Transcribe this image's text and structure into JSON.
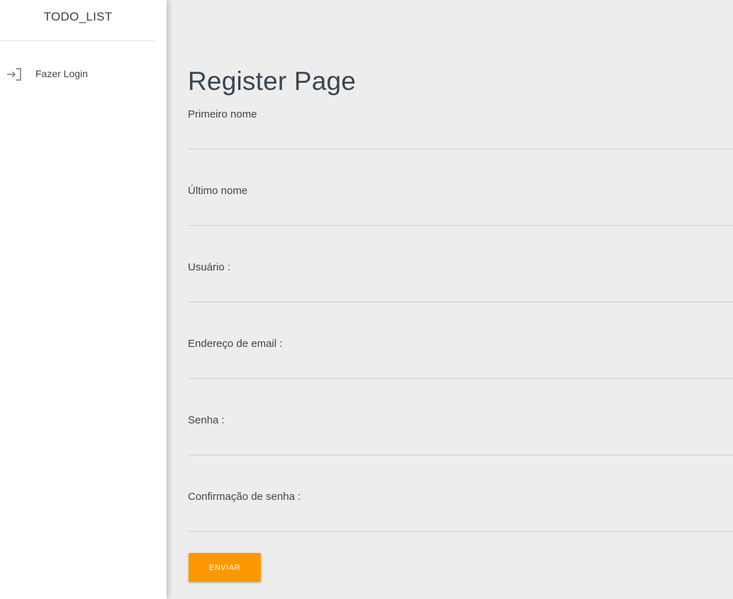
{
  "sidebar": {
    "title": "TODO_LIST",
    "items": [
      {
        "label": "Fazer Login",
        "icon": "login-icon"
      }
    ]
  },
  "main": {
    "title": "Register Page",
    "fields": [
      {
        "label": "Primeiro nome",
        "value": "",
        "placeholder": ""
      },
      {
        "label": "Último nome",
        "value": "",
        "placeholder": ""
      },
      {
        "label": "Usuário :",
        "value": "",
        "placeholder": ""
      },
      {
        "label": "Endereço de email :",
        "value": "",
        "placeholder": ""
      },
      {
        "label": "Senha :",
        "value": "",
        "placeholder": ""
      },
      {
        "label": "Confirmação de senha :",
        "value": "",
        "placeholder": ""
      }
    ],
    "submit_label": "ENVIAR"
  },
  "colors": {
    "accent": "#ff9800",
    "background": "#ededed",
    "sidebar": "#ffffff",
    "text": "#3c4650"
  }
}
